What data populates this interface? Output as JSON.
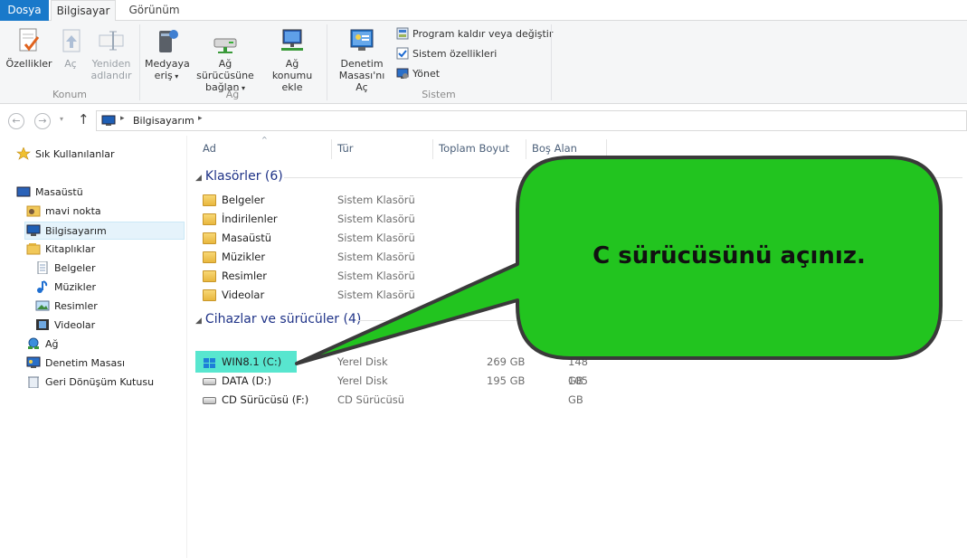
{
  "ribbon_tabs": {
    "file": "Dosya",
    "computer": "Bilgisayar",
    "view": "Görünüm"
  },
  "ribbon": {
    "properties": "Özellikler",
    "open": "Aç",
    "rename_1": "Yeniden",
    "rename_2": "adlandır",
    "group_location": "Konum",
    "media_1": "Medyaya",
    "media_2": "eriş",
    "map_drive_1": "Ağ sürücüsüne",
    "map_drive_2": "bağlan",
    "add_network_1": "Ağ konumu",
    "add_network_2": "ekle",
    "group_network": "Ağ",
    "control_panel_1": "Denetim",
    "control_panel_2": "Masası'nı Aç",
    "uninstall": "Program kaldır veya değiştir",
    "system_props": "Sistem özellikleri",
    "manage": "Yönet",
    "group_system": "Sistem"
  },
  "address": {
    "path": "Bilgisayarım"
  },
  "nav": {
    "favorites": "Sık Kullanılanlar",
    "desktop": "Masaüstü",
    "mavi": "mavi nokta",
    "computer": "Bilgisayarım",
    "libraries": "Kitaplıklar",
    "documents": "Belgeler",
    "music": "Müzikler",
    "pictures": "Resimler",
    "videos": "Videolar",
    "network": "Ağ",
    "control_panel": "Denetim Masası",
    "recycle": "Geri Dönüşüm Kutusu"
  },
  "columns": {
    "name": "Ad",
    "type": "Tür",
    "total": "Toplam Boyut",
    "free": "Boş Alan"
  },
  "groups": {
    "folders": "Klasörler (6)",
    "devices": "Cihazlar ve sürücüler (4)"
  },
  "folders": [
    {
      "name": "Belgeler",
      "type": "Sistem Klasörü"
    },
    {
      "name": "İndirilenler",
      "type": "Sistem Klasörü"
    },
    {
      "name": "Masaüstü",
      "type": "Sistem Klasörü"
    },
    {
      "name": "Müzikler",
      "type": "Sistem Klasörü"
    },
    {
      "name": "Resimler",
      "type": "Sistem Klasörü"
    },
    {
      "name": "Videolar",
      "type": "Sistem Klasörü"
    }
  ],
  "drives": [
    {
      "name": "WIN8.1 (C:)",
      "type": "Yerel Disk",
      "total": "269 GB",
      "free": "148 GB"
    },
    {
      "name": "DATA (D:)",
      "type": "Yerel Disk",
      "total": "195 GB",
      "free": "105 GB"
    },
    {
      "name": "CD Sürücüsü (F:)",
      "type": "CD Sürücüsü",
      "total": "",
      "free": ""
    }
  ],
  "callout": {
    "text": "C sürücüsünü açınız."
  },
  "colors": {
    "file_tab": "#1979ca",
    "callout_fill": "#22c41f",
    "highlight": "#58e6cf",
    "group_text": "#1e3287"
  }
}
